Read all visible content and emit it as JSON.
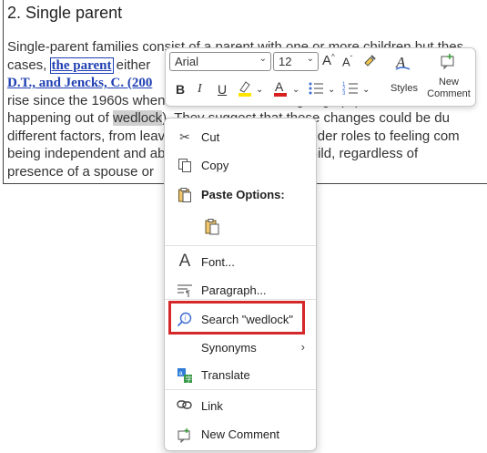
{
  "document": {
    "heading": "2. Single parent",
    "lines": [
      [
        "Single-parent families co",
        "nsist of a parent with one or more children but the",
        "s"
      ],
      [
        "cases, ",
        "the parent",
        " either"
      ],
      [
        "D.T., and Jencks, C. (200"
      ],
      [
        "rise since the 1960s when divorce rates started going up (and so did birth"
      ],
      [
        "happening out of ",
        "wedlock",
        "). They suggest that these changes could be du"
      ],
      [
        "different factors, from lea",
        "ving behind traditional gender roles to feeling com"
      ],
      [
        "being independent and a",
        "ble to manage raising a child, regardless of"
      ],
      [
        "presence of a spouse or"
      ]
    ]
  },
  "toolbar": {
    "font_name": "Arial",
    "font_size": "12",
    "styles_label": "Styles",
    "new_comment_label_1": "New",
    "new_comment_label_2": "Comment",
    "bold": "B",
    "italic": "I",
    "underline": "U"
  },
  "menu": {
    "items": [
      {
        "label": "Cut",
        "icon": "scissors-icon"
      },
      {
        "label": "Copy",
        "icon": "copy-icon"
      },
      {
        "label": "Paste Options:",
        "icon": "paste-icon"
      },
      {
        "label": "Font...",
        "icon": "font-icon"
      },
      {
        "label": "Paragraph...",
        "icon": "paragraph-icon"
      },
      {
        "label": "Search \"wedlock\"",
        "icon": "search-icon"
      },
      {
        "label": "Synonyms",
        "icon": ""
      },
      {
        "label": "Translate",
        "icon": "translate-icon"
      },
      {
        "label": "Link",
        "icon": "link-icon"
      },
      {
        "label": "New Comment",
        "icon": "new-comment-icon"
      }
    ]
  },
  "colors": {
    "highlight_box": "#d4282a",
    "link": "#1f3fb2",
    "selection": "#cfcfcf"
  }
}
